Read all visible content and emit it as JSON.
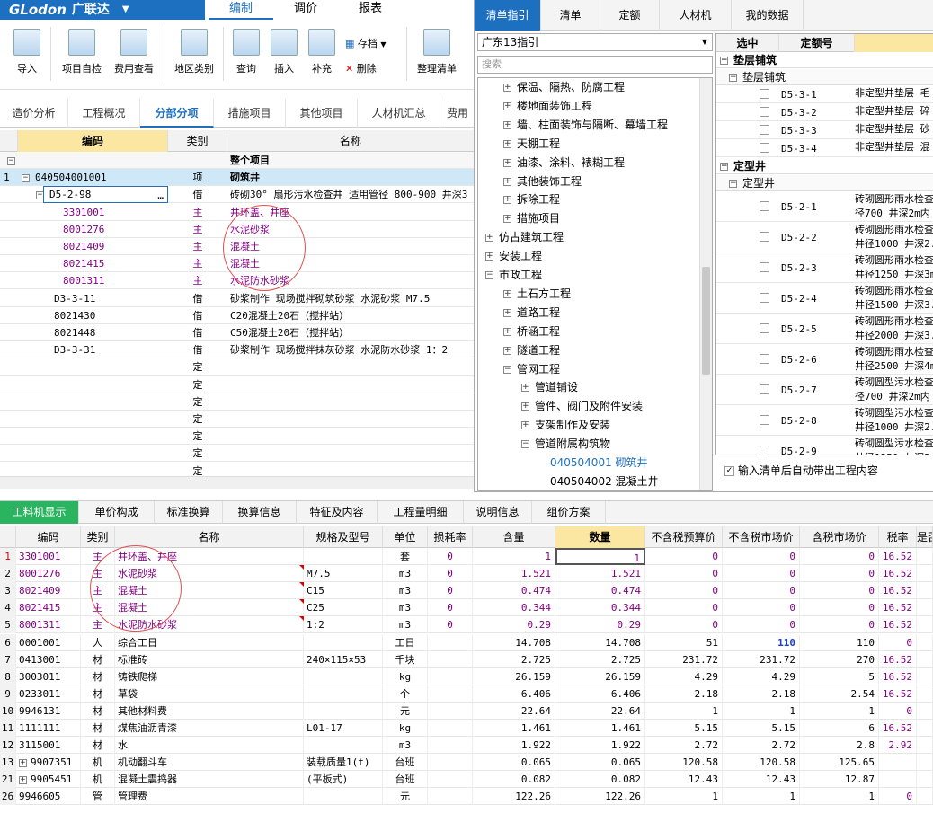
{
  "logo": {
    "text": "GLodon",
    "cn": "广联达"
  },
  "menu": [
    "编制",
    "调价",
    "报表"
  ],
  "ribbon": [
    {
      "label": "导入"
    },
    {
      "label": "项目自检"
    },
    {
      "label": "费用查看"
    },
    {
      "label": "地区类别"
    },
    {
      "label": "查询"
    },
    {
      "label": "插入"
    },
    {
      "label": "补充"
    },
    {
      "label": "存档"
    },
    {
      "label": "删除"
    },
    {
      "label": "整理清单"
    }
  ],
  "navtabs": [
    "造价分析",
    "工程概况",
    "分部分项",
    "措施项目",
    "其他项目",
    "人材机汇总",
    "费用"
  ],
  "grid1": {
    "headers": [
      "编码",
      "类别",
      "名称"
    ],
    "rows": [
      {
        "no": "",
        "code": "",
        "type": "",
        "name": "整个项目"
      },
      {
        "no": "1",
        "code": "040504001001",
        "type": "项",
        "name": "砌筑井"
      },
      {
        "no": "",
        "code": "D5-2-98",
        "type": "借",
        "name": "砖砌30° 扇形污水检查井 适用管径 800-900 井深3"
      },
      {
        "no": "",
        "code": "3301001",
        "type": "主",
        "name": "井环盖、井座"
      },
      {
        "no": "",
        "code": "8001276",
        "type": "主",
        "name": "水泥砂浆"
      },
      {
        "no": "",
        "code": "8021409",
        "type": "主",
        "name": "混凝土"
      },
      {
        "no": "",
        "code": "8021415",
        "type": "主",
        "name": "混凝土"
      },
      {
        "no": "",
        "code": "8001311",
        "type": "主",
        "name": "水泥防水砂浆"
      },
      {
        "no": "",
        "code": "D3-3-11",
        "type": "借",
        "name": "砂浆制作 现场搅拌砌筑砂浆 水泥砂浆 M7.5"
      },
      {
        "no": "",
        "code": "8021430",
        "type": "借",
        "name": "C20混凝土20石（搅拌站）"
      },
      {
        "no": "",
        "code": "8021448",
        "type": "借",
        "name": "C50混凝土20石（搅拌站）"
      },
      {
        "no": "",
        "code": "D3-3-31",
        "type": "借",
        "name": "砂浆制作 现场搅拌抹灰砂浆 水泥防水砂浆 1：2"
      },
      {
        "no": "",
        "code": "",
        "type": "定",
        "name": ""
      },
      {
        "no": "",
        "code": "",
        "type": "定",
        "name": ""
      },
      {
        "no": "",
        "code": "",
        "type": "定",
        "name": ""
      },
      {
        "no": "",
        "code": "",
        "type": "定",
        "name": ""
      },
      {
        "no": "",
        "code": "",
        "type": "定",
        "name": ""
      },
      {
        "no": "",
        "code": "",
        "type": "定",
        "name": ""
      },
      {
        "no": "",
        "code": "",
        "type": "定",
        "name": ""
      }
    ]
  },
  "right": {
    "tabs": [
      "清单指引",
      "清单",
      "定额",
      "人材机",
      "我的数据"
    ],
    "select": "广东13指引",
    "search_placeholder": "搜索",
    "tree": [
      {
        "t": "保温、隔热、防腐工程",
        "lv": 1,
        "pm": "+"
      },
      {
        "t": "楼地面装饰工程",
        "lv": 1,
        "pm": "+"
      },
      {
        "t": "墙、柱面装饰与隔断、幕墙工程",
        "lv": 1,
        "pm": "+"
      },
      {
        "t": "天棚工程",
        "lv": 1,
        "pm": "+"
      },
      {
        "t": "油漆、涂料、裱糊工程",
        "lv": 1,
        "pm": "+"
      },
      {
        "t": "其他装饰工程",
        "lv": 1,
        "pm": "+"
      },
      {
        "t": "拆除工程",
        "lv": 1,
        "pm": "+"
      },
      {
        "t": "措施项目",
        "lv": 1,
        "pm": "+"
      },
      {
        "t": "仿古建筑工程",
        "lv": 0,
        "pm": "+"
      },
      {
        "t": "安装工程",
        "lv": 0,
        "pm": "+"
      },
      {
        "t": "市政工程",
        "lv": 0,
        "pm": "-"
      },
      {
        "t": "土石方工程",
        "lv": 1,
        "pm": "+"
      },
      {
        "t": "道路工程",
        "lv": 1,
        "pm": "+"
      },
      {
        "t": "桥涵工程",
        "lv": 1,
        "pm": "+"
      },
      {
        "t": "隧道工程",
        "lv": 1,
        "pm": "+"
      },
      {
        "t": "管网工程",
        "lv": 1,
        "pm": "-"
      },
      {
        "t": "管道铺设",
        "lv": 2,
        "pm": "+"
      },
      {
        "t": "管件、阀门及附件安装",
        "lv": 2,
        "pm": "+"
      },
      {
        "t": "支架制作及安装",
        "lv": 2,
        "pm": "+"
      },
      {
        "t": "管道附属构筑物",
        "lv": 2,
        "pm": "-"
      },
      {
        "t": "040504001   砌筑井",
        "lv": 3,
        "pm": "",
        "blue": true
      },
      {
        "t": "040504002   混凝土井",
        "lv": 3,
        "pm": ""
      }
    ],
    "qhead": [
      "选中",
      "定额号"
    ],
    "groups": [
      {
        "title": "垫层铺筑",
        "sub": "垫层铺筑",
        "rows": [
          {
            "code": "D5-3-1",
            "name": "非定型井垫层 毛"
          },
          {
            "code": "D5-3-2",
            "name": "非定型井垫层 碎"
          },
          {
            "code": "D5-3-3",
            "name": "非定型井垫层 砂"
          },
          {
            "code": "D5-3-4",
            "name": "非定型井垫层 混"
          }
        ]
      },
      {
        "title": "定型井",
        "sub": "定型井",
        "rows": [
          {
            "code": "D5-2-1",
            "name": "砖砌圆形雨水检查",
            "name2": "径700 井深2m内"
          },
          {
            "code": "D5-2-2",
            "name": "砖砌圆形雨水检查",
            "name2": "井径1000 井深2."
          },
          {
            "code": "D5-2-3",
            "name": "砖砌圆形雨水检查",
            "name2": "井径1250 井深3m"
          },
          {
            "code": "D5-2-4",
            "name": "砖砌圆形雨水检查",
            "name2": "井径1500 井深3."
          },
          {
            "code": "D5-2-5",
            "name": "砖砌圆形雨水检查",
            "name2": "井径2000 井深3."
          },
          {
            "code": "D5-2-6",
            "name": "砖砌圆形雨水检查",
            "name2": "井径2500 井深4m"
          },
          {
            "code": "D5-2-7",
            "name": "砖砌圆型污水检查",
            "name2": "径700 井深2m内"
          },
          {
            "code": "D5-2-8",
            "name": "砖砌圆型污水检查",
            "name2": "井径1000 井深2."
          },
          {
            "code": "D5-2-9",
            "name": "砖砌圆型污水检查",
            "name2": "井径1250 井深3m"
          }
        ]
      }
    ],
    "checkbox_label": "输入清单后自动带出工程内容"
  },
  "btabs": [
    "工料机显示",
    "单价构成",
    "标准换算",
    "换算信息",
    "特征及内容",
    "工程量明细",
    "说明信息",
    "组价方案"
  ],
  "grid2": {
    "headers": [
      "编码",
      "类别",
      "名称",
      "规格及型号",
      "单位",
      "损耗率",
      "含量",
      "数量",
      "不含税预算价",
      "不含税市场价",
      "含税市场价",
      "税率",
      "是否"
    ],
    "rows": [
      {
        "no": "1",
        "code": "3301001",
        "type": "主",
        "name": "井环盖、井座",
        "spec": "",
        "unit": "套",
        "loss": "0",
        "qty": "1",
        "amt": "1",
        "p1": "0",
        "p2": "0",
        "p3": "0",
        "tax": "16.52",
        "purple": true,
        "flag": false
      },
      {
        "no": "2",
        "code": "8001276",
        "type": "主",
        "name": "水泥砂浆",
        "spec": "M7.5",
        "unit": "m3",
        "loss": "0",
        "qty": "1.521",
        "amt": "1.521",
        "p1": "0",
        "p2": "0",
        "p3": "0",
        "tax": "16.52",
        "purple": true,
        "flag": true
      },
      {
        "no": "3",
        "code": "8021409",
        "type": "主",
        "name": "混凝土",
        "spec": "C15",
        "unit": "m3",
        "loss": "0",
        "qty": "0.474",
        "amt": "0.474",
        "p1": "0",
        "p2": "0",
        "p3": "0",
        "tax": "16.52",
        "purple": true,
        "flag": true
      },
      {
        "no": "4",
        "code": "8021415",
        "type": "主",
        "name": "混凝土",
        "spec": "C25",
        "unit": "m3",
        "loss": "0",
        "qty": "0.344",
        "amt": "0.344",
        "p1": "0",
        "p2": "0",
        "p3": "0",
        "tax": "16.52",
        "purple": true,
        "flag": true
      },
      {
        "no": "5",
        "code": "8001311",
        "type": "主",
        "name": "水泥防水砂浆",
        "spec": "1:2",
        "unit": "m3",
        "loss": "0",
        "qty": "0.29",
        "amt": "0.29",
        "p1": "0",
        "p2": "0",
        "p3": "0",
        "tax": "16.52",
        "purple": true,
        "flag": true
      },
      {
        "no": "6",
        "code": "0001001",
        "type": "人",
        "name": "综合工日",
        "spec": "",
        "unit": "工日",
        "loss": "",
        "qty": "14.708",
        "amt": "14.708",
        "p1": "51",
        "p2": "110",
        "p3": "110",
        "tax": "0",
        "purple": false,
        "flag": false,
        "bold2": true
      },
      {
        "no": "7",
        "code": "0413001",
        "type": "材",
        "name": "标准砖",
        "spec": "240×115×53",
        "unit": "千块",
        "loss": "",
        "qty": "2.725",
        "amt": "2.725",
        "p1": "231.72",
        "p2": "231.72",
        "p3": "270",
        "tax": "16.52",
        "purple": false,
        "flag": false
      },
      {
        "no": "8",
        "code": "3003011",
        "type": "材",
        "name": "铸铁爬梯",
        "spec": "",
        "unit": "kg",
        "loss": "",
        "qty": "26.159",
        "amt": "26.159",
        "p1": "4.29",
        "p2": "4.29",
        "p3": "5",
        "tax": "16.52",
        "purple": false,
        "flag": false
      },
      {
        "no": "9",
        "code": "0233011",
        "type": "材",
        "name": "草袋",
        "spec": "",
        "unit": "个",
        "loss": "",
        "qty": "6.406",
        "amt": "6.406",
        "p1": "2.18",
        "p2": "2.18",
        "p3": "2.54",
        "tax": "16.52",
        "purple": false,
        "flag": false
      },
      {
        "no": "10",
        "code": "9946131",
        "type": "材",
        "name": "其他材料费",
        "spec": "",
        "unit": "元",
        "loss": "",
        "qty": "22.64",
        "amt": "22.64",
        "p1": "1",
        "p2": "1",
        "p3": "1",
        "tax": "0",
        "purple": false,
        "flag": false
      },
      {
        "no": "11",
        "code": "1111111",
        "type": "材",
        "name": "煤焦油沥青漆",
        "spec": "L01-17",
        "unit": "kg",
        "loss": "",
        "qty": "1.461",
        "amt": "1.461",
        "p1": "5.15",
        "p2": "5.15",
        "p3": "6",
        "tax": "16.52",
        "purple": false,
        "flag": false
      },
      {
        "no": "12",
        "code": "3115001",
        "type": "材",
        "name": "水",
        "spec": "",
        "unit": "m3",
        "loss": "",
        "qty": "1.922",
        "amt": "1.922",
        "p1": "2.72",
        "p2": "2.72",
        "p3": "2.8",
        "tax": "2.92",
        "purple": false,
        "flag": false
      },
      {
        "no": "13",
        "code": "9907351",
        "type": "机",
        "name": "机动翻斗车",
        "spec": "装载质量1(t)",
        "unit": "台班",
        "loss": "",
        "qty": "0.065",
        "amt": "0.065",
        "p1": "120.58",
        "p2": "120.58",
        "p3": "125.65",
        "tax": "",
        "purple": false,
        "flag": false,
        "plus": true
      },
      {
        "no": "21",
        "code": "9905451",
        "type": "机",
        "name": "混凝土震捣器",
        "spec": "(平板式)",
        "unit": "台班",
        "loss": "",
        "qty": "0.082",
        "amt": "0.082",
        "p1": "12.43",
        "p2": "12.43",
        "p3": "12.87",
        "tax": "",
        "purple": false,
        "flag": false,
        "plus": true
      },
      {
        "no": "26",
        "code": "9946605",
        "type": "管",
        "name": "管理费",
        "spec": "",
        "unit": "元",
        "loss": "",
        "qty": "122.26",
        "amt": "122.26",
        "p1": "1",
        "p2": "1",
        "p3": "1",
        "tax": "0",
        "purple": false,
        "flag": false
      }
    ]
  }
}
